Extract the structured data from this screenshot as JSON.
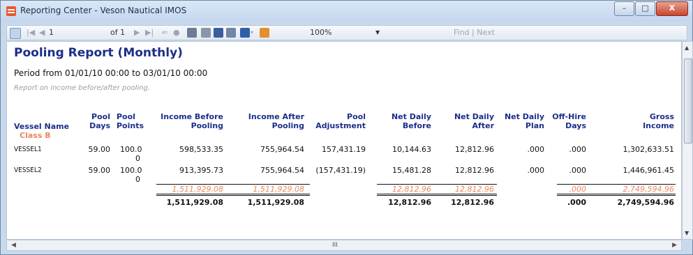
{
  "window": {
    "title": "Reporting Center - Veson Nautical IMOS",
    "controls": [
      "–",
      "□",
      "X"
    ]
  },
  "toolbar": {
    "page_current": "1",
    "page_of": "of 1",
    "zoom": "100%",
    "find": "Find",
    "separator": "|",
    "next": "Next"
  },
  "report": {
    "title": "Pooling Report (Monthly)",
    "period": "Period from 01/01/10  00:00 to 03/01/10  00:00",
    "note": "Report on income before/after pooling.",
    "headers": {
      "vessel": "Vessel Name",
      "pool_days": [
        "Pool",
        "Days"
      ],
      "pool_points": [
        "Pool",
        "Points"
      ],
      "income_before": [
        "Income Before",
        "Pooling"
      ],
      "income_after": [
        "Income After",
        "Pooling"
      ],
      "pool_adj": [
        "Pool",
        "Adjustment"
      ],
      "net_before": [
        "Net Daily",
        "Before"
      ],
      "net_after": [
        "Net Daily",
        "After"
      ],
      "net_plan": [
        "Net Daily",
        "Plan"
      ],
      "offhire": [
        "Off-Hire",
        "Days"
      ],
      "gross": [
        "Gross",
        "Income"
      ]
    },
    "class_label": "Class B",
    "rows": [
      {
        "vessel": "VESSEL1",
        "pool_days": "59.00",
        "pool_points": [
          "100.0",
          "0"
        ],
        "income_before": "598,533.35",
        "income_after": "755,964.54",
        "pool_adj": "157,431.19",
        "net_before": "10,144.63",
        "net_after": "12,812.96",
        "net_plan": ".000",
        "offhire": ".000",
        "gross": "1,302,633.51"
      },
      {
        "vessel": "VESSEL2",
        "pool_days": "59.00",
        "pool_points": [
          "100.0",
          "0"
        ],
        "income_before": "913,395.73",
        "income_after": "755,964.54",
        "pool_adj": "(157,431.19)",
        "net_before": "15,481.28",
        "net_after": "12,812.96",
        "net_plan": ".000",
        "offhire": ".000",
        "gross": "1,446,961.45"
      }
    ],
    "subtotal": {
      "income_before": "1,511,929.08",
      "income_after": "1,511,929.08",
      "net_before": "12,812.96",
      "net_after": "12,812.96",
      "offhire": ".000",
      "gross": "2,749,594.96"
    },
    "total": {
      "income_before": "1,511,929.08",
      "income_after": "1,511,929.08",
      "net_before": "12,812.96",
      "net_after": "12,812.96",
      "offhire": ".000",
      "gross": "2,749,594.96"
    }
  },
  "hscroll_marker": "III",
  "colors": {
    "title_blue": "#1c2e8a",
    "accent_orange": "#e8875f"
  }
}
